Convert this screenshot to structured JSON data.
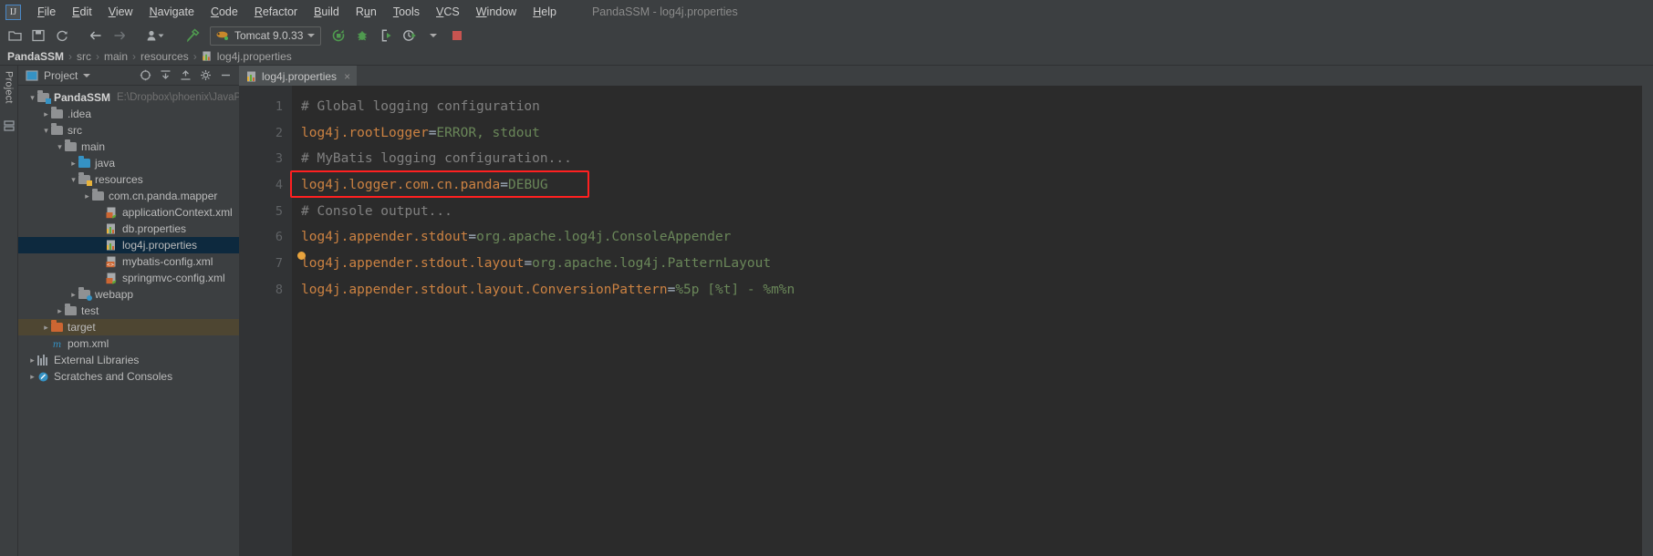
{
  "window": {
    "title": "PandaSSM - log4j.properties",
    "logo_text": "IJ"
  },
  "menubar": {
    "items": [
      {
        "label": "File",
        "mnemonic": "F"
      },
      {
        "label": "Edit",
        "mnemonic": "E"
      },
      {
        "label": "View",
        "mnemonic": "V"
      },
      {
        "label": "Navigate",
        "mnemonic": "N"
      },
      {
        "label": "Code",
        "mnemonic": "C"
      },
      {
        "label": "Refactor",
        "mnemonic": "R"
      },
      {
        "label": "Build",
        "mnemonic": "B"
      },
      {
        "label": "Run",
        "mnemonic": "u"
      },
      {
        "label": "Tools",
        "mnemonic": "T"
      },
      {
        "label": "VCS",
        "mnemonic": "V"
      },
      {
        "label": "Window",
        "mnemonic": "W"
      },
      {
        "label": "Help",
        "mnemonic": "H"
      }
    ]
  },
  "toolbar": {
    "open_icon": "open-folder-icon",
    "save_icon": "save-icon",
    "sync_icon": "refresh-icon",
    "back_icon": "back-arrow-icon",
    "forward_icon": "forward-arrow-icon",
    "profile_icon": "user-profile-icon",
    "build_icon": "hammer-icon",
    "run_config": {
      "label": "Tomcat 9.0.33",
      "icon": "tomcat-icon"
    },
    "run_icon": "run-icon",
    "debug_icon": "debug-bug-icon",
    "run_with_coverage_icon": "run-coverage-icon",
    "profiler_icon": "profiler-icon",
    "stop_icon": "stop-icon"
  },
  "breadcrumb": {
    "items": [
      "PandaSSM",
      "src",
      "main",
      "resources",
      "log4j.properties"
    ],
    "separator": "›"
  },
  "left_strip": {
    "tabs": [
      "Project"
    ],
    "structure_icon": "structure-icon"
  },
  "project_panel": {
    "title": "Project",
    "dropdown_icon": "chevron-down-icon",
    "tools": [
      "locate-icon",
      "collapse-all-icon",
      "expand-all-icon",
      "settings-gear-icon",
      "hide-icon"
    ],
    "tree": [
      {
        "label": "PandaSSM",
        "path": "E:\\Dropbox\\phoenix\\JavaPro",
        "indent": 0,
        "arrow": "expanded",
        "icon": "module-folder-icon",
        "bold": true,
        "state": "normal"
      },
      {
        "label": ".idea",
        "indent": 1,
        "arrow": "collapsed",
        "icon": "folder-icon",
        "state": "normal"
      },
      {
        "label": "src",
        "indent": 1,
        "arrow": "expanded",
        "icon": "folder-icon",
        "state": "normal"
      },
      {
        "label": "main",
        "indent": 2,
        "arrow": "expanded",
        "icon": "folder-icon",
        "state": "normal"
      },
      {
        "label": "java",
        "indent": 3,
        "arrow": "collapsed",
        "icon": "source-folder-icon",
        "state": "normal"
      },
      {
        "label": "resources",
        "indent": 3,
        "arrow": "expanded",
        "icon": "resource-folder-icon",
        "state": "normal"
      },
      {
        "label": "com.cn.panda.mapper",
        "indent": 4,
        "arrow": "collapsed",
        "icon": "folder-icon",
        "state": "normal"
      },
      {
        "label": "applicationContext.xml",
        "indent": 5,
        "arrow": "none",
        "icon": "spring-xml-icon",
        "state": "normal"
      },
      {
        "label": "db.properties",
        "indent": 5,
        "arrow": "none",
        "icon": "properties-icon",
        "state": "normal"
      },
      {
        "label": "log4j.properties",
        "indent": 5,
        "arrow": "none",
        "icon": "properties-icon",
        "state": "selected"
      },
      {
        "label": "mybatis-config.xml",
        "indent": 5,
        "arrow": "none",
        "icon": "xml-icon",
        "state": "normal"
      },
      {
        "label": "springmvc-config.xml",
        "indent": 5,
        "arrow": "none",
        "icon": "spring-xml-icon",
        "state": "normal"
      },
      {
        "label": "webapp",
        "indent": 3,
        "arrow": "collapsed",
        "icon": "web-folder-icon",
        "state": "normal"
      },
      {
        "label": "test",
        "indent": 2,
        "arrow": "collapsed",
        "icon": "folder-icon",
        "state": "normal"
      },
      {
        "label": "target",
        "indent": 1,
        "arrow": "collapsed",
        "icon": "excluded-folder-icon",
        "state": "highlighted"
      },
      {
        "label": "pom.xml",
        "indent": 1,
        "arrow": "none",
        "icon": "maven-icon",
        "state": "normal"
      },
      {
        "label": "External Libraries",
        "indent": 0,
        "arrow": "collapsed",
        "icon": "libraries-icon",
        "state": "normal"
      },
      {
        "label": "Scratches and Consoles",
        "indent": 0,
        "arrow": "collapsed",
        "icon": "scratches-icon",
        "state": "normal"
      }
    ]
  },
  "editor": {
    "tab": {
      "label": "log4j.properties",
      "icon": "properties-icon",
      "close_label": "×"
    },
    "line_numbers": [
      "1",
      "2",
      "3",
      "4",
      "5",
      "6",
      "7",
      "8"
    ],
    "lines": [
      {
        "n": 1,
        "type": "comment",
        "text": "# Global logging configuration"
      },
      {
        "n": 2,
        "type": "property",
        "key": "log4j.rootLogger",
        "value": "ERROR, stdout"
      },
      {
        "n": 3,
        "type": "comment",
        "text": "# MyBatis logging configuration..."
      },
      {
        "n": 4,
        "type": "property",
        "key": "log4j.logger.com.cn.panda",
        "value": "DEBUG",
        "annotated": true
      },
      {
        "n": 5,
        "type": "comment",
        "text": "# Console output..."
      },
      {
        "n": 6,
        "type": "property",
        "key": "log4j.appender.stdout",
        "value": "org.apache.log4j.ConsoleAppender"
      },
      {
        "n": 7,
        "type": "property",
        "key": "log4j.appender.stdout.layout",
        "value": "org.apache.log4j.PatternLayout"
      },
      {
        "n": 8,
        "type": "property",
        "key": "log4j.appender.stdout.layout.ConversionPattern",
        "value": "%5p [%t] - %m%n"
      }
    ],
    "annotation": {
      "shape": "rectangle",
      "color": "#ff2020",
      "target_line": 4
    },
    "intention_bulb": {
      "icon": "intention-bulb-icon",
      "color": "#e8a33d",
      "line": 7
    }
  },
  "colors": {
    "background": "#3c3f41",
    "editor_background": "#2b2b2b",
    "gutter": "#313335",
    "comment": "#808080",
    "key": "#cc8242",
    "value": "#6a8759",
    "selection": "#0d293e",
    "highlight": "#4e4632",
    "accent_red": "#ff2020"
  }
}
